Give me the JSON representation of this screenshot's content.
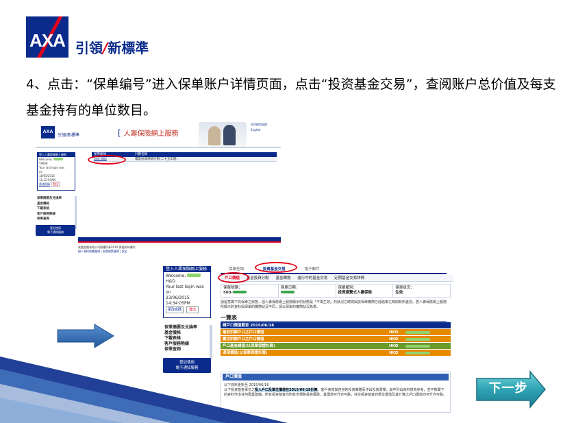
{
  "header": {
    "logo_text": "AXA",
    "brand_left": "引領",
    "brand_sep": "/",
    "brand_right": "新標準"
  },
  "instruction": "4、点击：“保单编号”进入保单账户详情页面，点击“投资基金交易”，查阅账户总价值及每支基金持有的单位数目。",
  "screenshot1": {
    "logo": "AXA",
    "brand": "引領/新標準",
    "title": "人壽保險網上服務",
    "top_links": [
      "初次使用支援",
      "English"
    ],
    "login": {
      "header": "登入人壽保險網上服務",
      "welcome": "Welcome,",
      "name": "YIMUR",
      "last_login": "Your last login was",
      "on": "on",
      "date": "18/05/2015",
      "time": "11:22:59AM",
      "change_password": "更改密碼",
      "logout": "登出"
    },
    "menu": [
      "保單摘要及兌換率",
      "基金價格",
      "下載表格",
      "客戶服務熱線",
      "保單查詢"
    ],
    "notif": [
      "登記使用",
      "電子通知服務"
    ],
    "table": {
      "col1": "保單編號",
      "col2": "計劃名稱",
      "policy": "503-383",
      "plan": "積富投資保險計劃(二十五年期)"
    },
    "footer_1": "安盛金融有限公司版權所有2014 保留所有權利",
    "footer_2": "個人資料收集聲明 | 私隱政策聲明 | 安全"
  },
  "screenshot2": {
    "login": {
      "header": "登入人壽保險網上服務",
      "welcome": "Welcome,",
      "name": "H&D",
      "last_login": "Your last login was",
      "on": "on",
      "date": "23/06/2015",
      "time": "14:34:05PM",
      "change_password": "更改密碼",
      "logout": "登出"
    },
    "menu": [
      "保單摘要及兌換率",
      "基金價格",
      "下載表格",
      "客戶服務熱線",
      "保單查詢"
    ],
    "notif": [
      "登記使用",
      "電子通知服務"
    ],
    "tabs": [
      "保單查詢",
      "投資基金交易",
      "電子郵件"
    ],
    "subtabs": [
      "戶口價值",
      "基金投資分配",
      "基金轉換",
      "進行中的基金交易",
      "定期基金交易詳情"
    ],
    "info": {
      "no_label": "保單號碼：",
      "no_value": "503-",
      "date_label": "保單日期：",
      "type_label": "保單類別：",
      "type_value": "投資連繫式人壽保險",
      "status_label": "保單狀況：",
      "status_value": "生效"
    },
    "note": "請留意閣下的保單之狀態，因人壽保險網上服務顯示的狀態是「不再生效」的狀況之時間與該保單實際已經結束之時間有所差別。若人壽保險網上服務所顯示的資料與保單的實際狀況不同，請以保單的實際狀況為準。",
    "overview_title": "一覽表",
    "value_rows": [
      {
        "label": "總戶口價值截至 2015/06/18",
        "currency": "",
        "style": "r-head"
      },
      {
        "label": "最初供款戶口之戶口價值",
        "currency": "HKD",
        "style": "r-orange"
      },
      {
        "label": "靈活供款戶口之戶口價值",
        "currency": "HKD",
        "style": "r-orange"
      },
      {
        "label": "戶口基金總值(以保單保證計算)",
        "currency": "HKD",
        "style": "r-green"
      },
      {
        "label": "退保價值(以保單保證計算)",
        "currency": "HKD",
        "style": "r-orange"
      }
    ],
    "account_value": {
      "title": "戶口價值",
      "date_line": "以下資料更新至 2015/06/18",
      "text_1": "以下投資基金單位之",
      "text_hl": "投入戶口及單位價值在2015/06/18計算",
      "text_2": "。客戶會按其自身的投資策略而作出投資選擇，其中列出資料僅為參考，並不對閣下的資料作出任何專業建議。所有投資基金均附有市場和投資風險，其價值可升亦可跌，往往投資基金的單位價值及其計算之戶口價值均可升亦可跌。"
    }
  },
  "next_button": "下一步",
  "colors": {
    "axa_blue": "#0a2b8c",
    "axa_red": "#e3001b",
    "orange_row": "#e68a00",
    "green_row": "#6b9b2a",
    "arrow_blue": "#2f6fb3"
  }
}
